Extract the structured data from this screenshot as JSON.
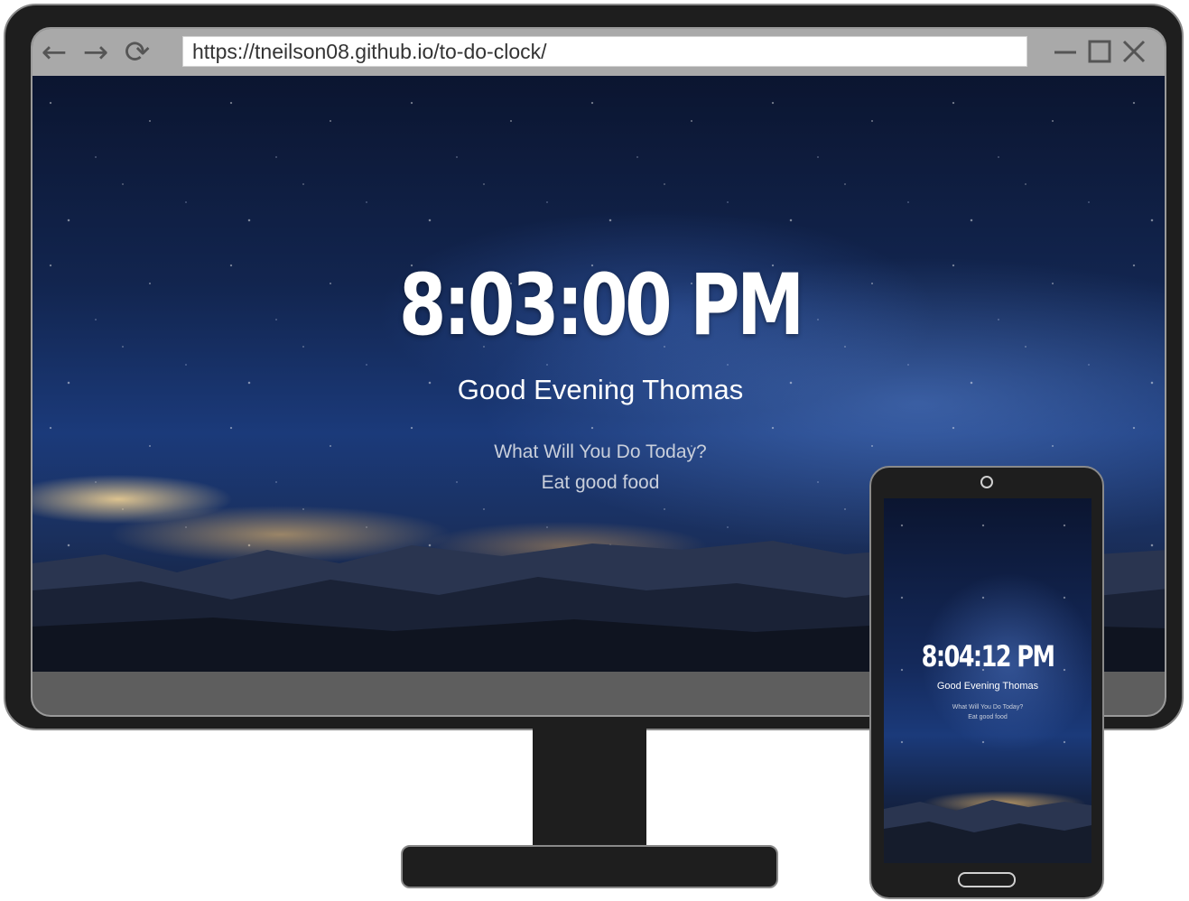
{
  "browser": {
    "url": "https://tneilson08.github.io/to-do-clock/",
    "back_icon": "arrow-left",
    "forward_icon": "arrow-right",
    "reload_icon": "reload",
    "minimize_icon": "minimize",
    "maximize_icon": "maximize",
    "close_icon": "close"
  },
  "desktop": {
    "time": "8:03:00 PM",
    "greeting": "Good Evening Thomas",
    "prompt": "What Will You Do Today?",
    "focus": "Eat good food"
  },
  "mobile": {
    "time": "8:04:12 PM",
    "greeting": "Good Evening Thomas",
    "prompt": "What Will You Do Today?",
    "focus": "Eat good food"
  },
  "colors": {
    "device_body": "#1e1e1e",
    "browser_bar": "#a9a9a9",
    "sky_deep": "#0b1530",
    "sky_glow": "#1b3a7a",
    "horizon_glow": "#f0be6e"
  }
}
